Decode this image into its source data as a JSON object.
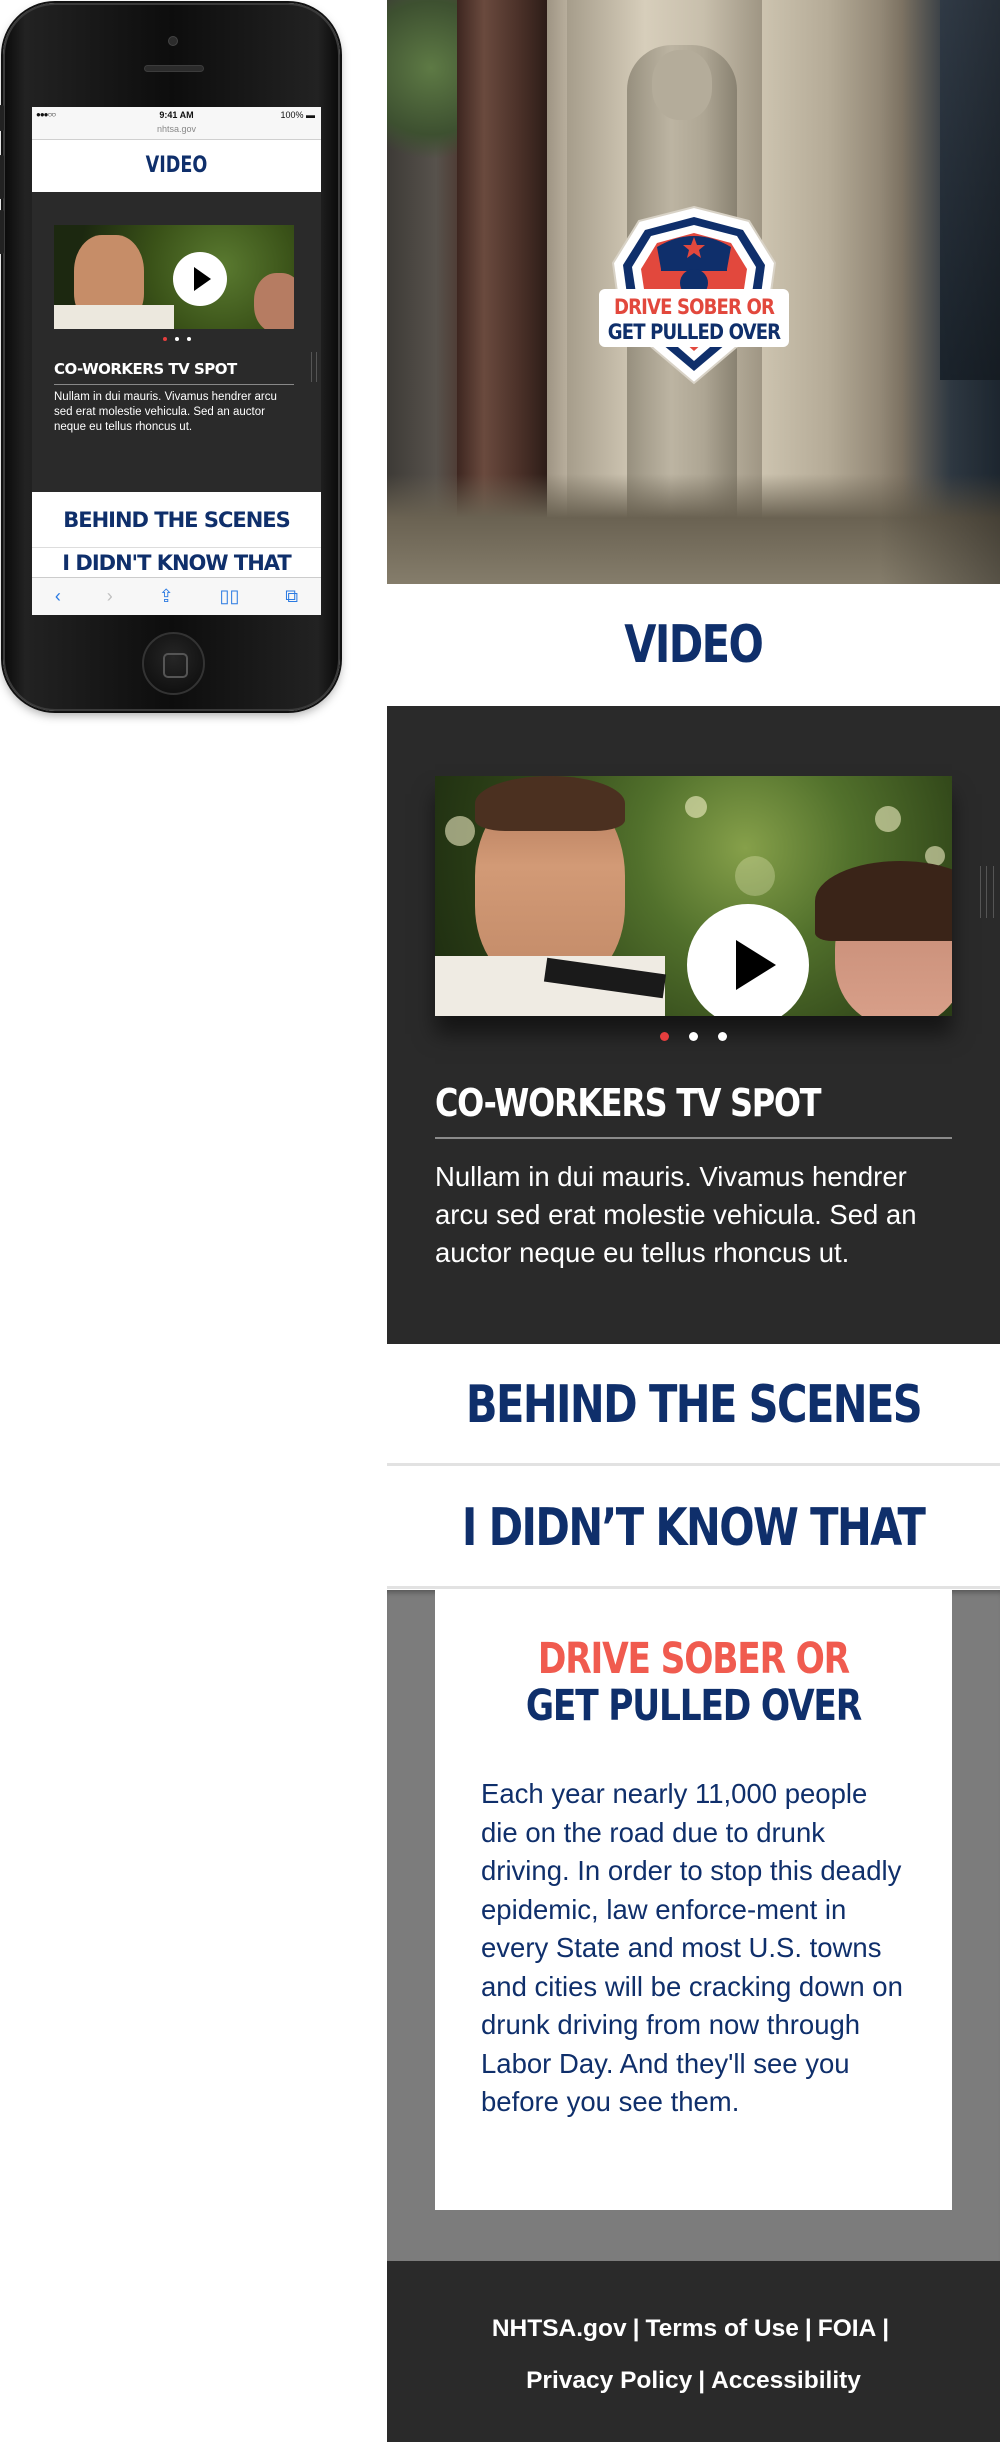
{
  "phone": {
    "status_signal": "●●●○○",
    "status_time": "9:41 AM",
    "status_battery": "100% ▬",
    "url": "nhtsa.gov",
    "heading": "VIDEO",
    "video_title": "CO-WORKERS TV SPOT",
    "video_desc": "Nullam in dui mauris. Vivamus hendrer arcu sed erat molestie vehicula. Sed an auctor neque eu tellus rhoncus ut.",
    "menu_1": "BEHIND THE SCENES",
    "menu_2": "I DIDN'T KNOW THAT",
    "toolbar": {
      "back": "‹",
      "forward": "›",
      "share": "⇪",
      "bookmarks": "▯▯",
      "tabs": "⧉"
    }
  },
  "hero": {
    "badge_line1": "DRIVE SOBER OR",
    "badge_line2": "GET PULLED OVER"
  },
  "main": {
    "heading": "VIDEO",
    "video_title": "CO-WORKERS TV SPOT",
    "video_desc": "Nullam in dui mauris. Vivamus hendrer arcu sed erat molestie vehicula. Sed an auctor neque eu tellus rhoncus ut.",
    "carousel": {
      "count": 3,
      "active": 1
    },
    "menu_1": "BEHIND THE SCENES",
    "menu_2": "I DIDN’T KNOW THAT",
    "card_title_line1": "DRIVE SOBER OR",
    "card_title_line2": "GET PULLED OVER",
    "card_body": "Each year nearly 11,000 people die on the road due to drunk driving. In order to stop this deadly epidemic, law enforce-ment in every State and most U.S. towns and cities will be cracking down on drunk driving from now through Labor Day. And they'll see you before you see them."
  },
  "footer": {
    "links_row1": [
      "NHTSA.gov",
      "Terms of Use",
      "FOIA"
    ],
    "links_row2": [
      "Privacy Policy",
      "Accessibility"
    ],
    "separator": "|"
  },
  "colors": {
    "navy": "#0f2f6b",
    "red": "#f05b4f",
    "dark_panel": "#2a2a2a",
    "grey_panel": "#7c7c7c"
  }
}
